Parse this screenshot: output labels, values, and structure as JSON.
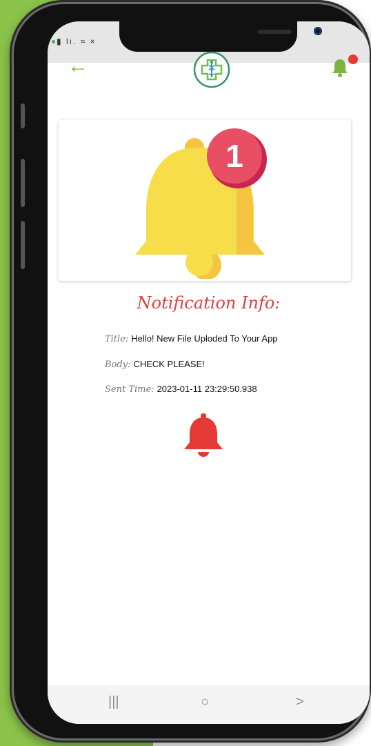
{
  "statusbar": {
    "icons_text": "▮ lı. ≈ ×"
  },
  "appbar": {
    "back_icon": "←"
  },
  "notification": {
    "badge_count": "1",
    "heading": "Notification Info:",
    "title_label": "Title:",
    "title_value": "Hello! New File Uploded To Your App",
    "body_label": "Body:",
    "body_value": "CHECK PLEASE!",
    "time_label": "Sent Time:",
    "time_value": "2023-01-11 23:29:50.938"
  },
  "navbar": {
    "recent_icon": "|||",
    "home_icon": "○",
    "back_icon": ">"
  },
  "colors": {
    "accent_green": "#7cb342",
    "heading_red": "#d64541",
    "bell_yellow": "#f5d547",
    "badge_red": "#e94f64"
  }
}
